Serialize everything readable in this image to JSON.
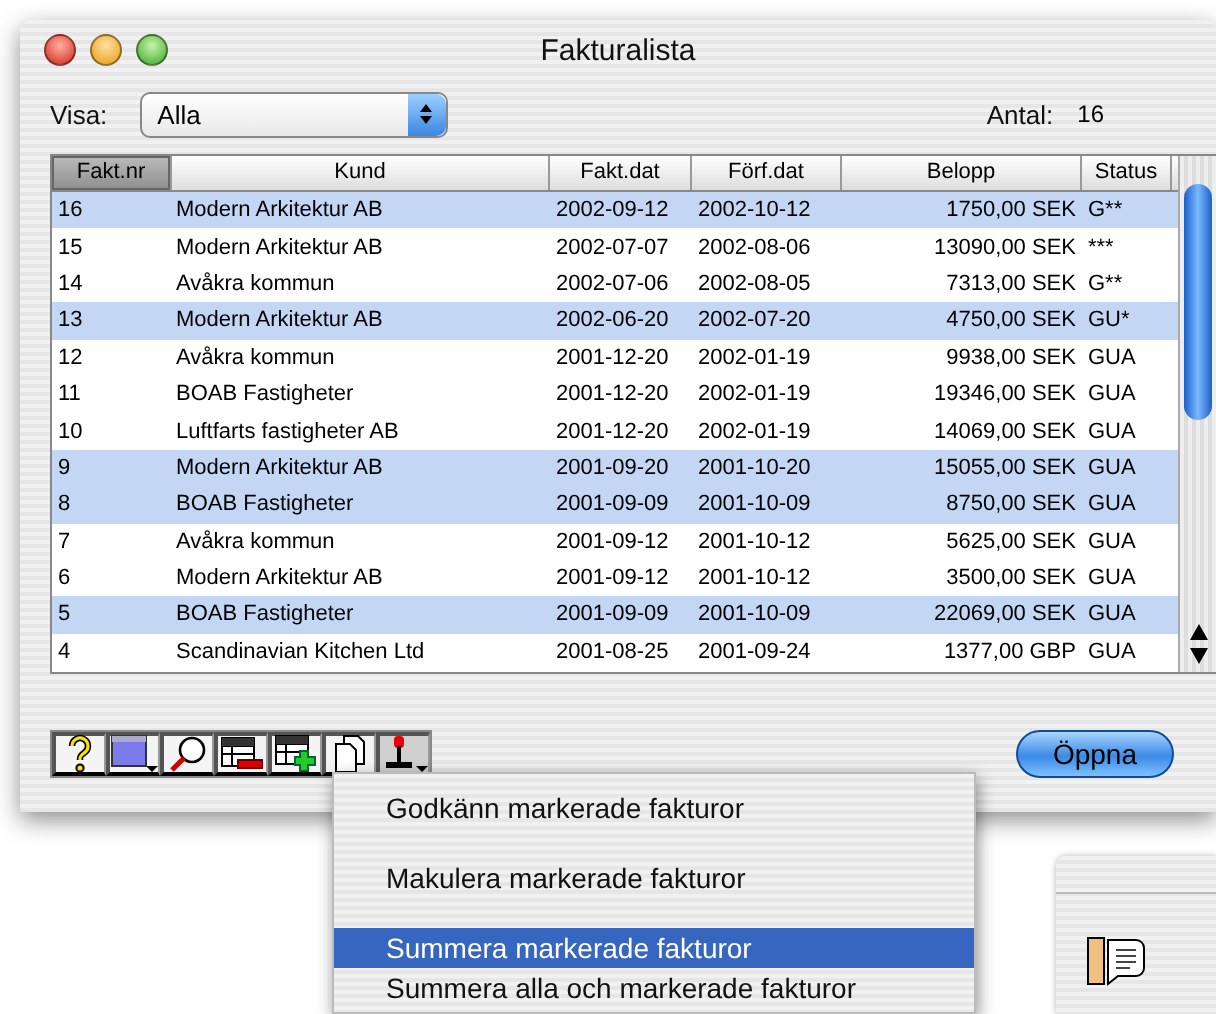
{
  "window": {
    "title": "Fakturalista"
  },
  "filter": {
    "label": "Visa:",
    "value": "Alla"
  },
  "count": {
    "label": "Antal:",
    "value": "16"
  },
  "table": {
    "columns": [
      {
        "label": "Fakt.nr",
        "sorted": true
      },
      {
        "label": "Kund",
        "sorted": false
      },
      {
        "label": "Fakt.dat",
        "sorted": false
      },
      {
        "label": "Förf.dat",
        "sorted": false
      },
      {
        "label": "Belopp",
        "sorted": false
      },
      {
        "label": "Status",
        "sorted": false
      }
    ],
    "rows": [
      {
        "cells": [
          "16",
          "Modern Arkitektur AB",
          "2002-09-12",
          "2002-10-12",
          "1750,00 SEK",
          "G**"
        ],
        "selected": true
      },
      {
        "cells": [
          "15",
          "Modern Arkitektur AB",
          "2002-07-07",
          "2002-08-06",
          "13090,00 SEK",
          "***"
        ],
        "selected": false
      },
      {
        "cells": [
          "14",
          "Avåkra kommun",
          "2002-07-06",
          "2002-08-05",
          "7313,00 SEK",
          "G**"
        ],
        "selected": false
      },
      {
        "cells": [
          "13",
          "Modern Arkitektur AB",
          "2002-06-20",
          "2002-07-20",
          "4750,00 SEK",
          "GU*"
        ],
        "selected": true
      },
      {
        "cells": [
          "12",
          "Avåkra kommun",
          "2001-12-20",
          "2002-01-19",
          "9938,00 SEK",
          "GUA"
        ],
        "selected": false
      },
      {
        "cells": [
          "11",
          "BOAB Fastigheter",
          "2001-12-20",
          "2002-01-19",
          "19346,00 SEK",
          "GUA"
        ],
        "selected": false
      },
      {
        "cells": [
          "10",
          "Luftfarts fastigheter AB",
          "2001-12-20",
          "2002-01-19",
          "14069,00 SEK",
          "GUA"
        ],
        "selected": false
      },
      {
        "cells": [
          "9",
          "Modern Arkitektur AB",
          "2001-09-20",
          "2001-10-20",
          "15055,00 SEK",
          "GUA"
        ],
        "selected": true
      },
      {
        "cells": [
          "8",
          "BOAB Fastigheter",
          "2001-09-09",
          "2001-10-09",
          "8750,00 SEK",
          "GUA"
        ],
        "selected": true
      },
      {
        "cells": [
          "7",
          "Avåkra kommun",
          "2001-09-12",
          "2001-10-12",
          "5625,00 SEK",
          "GUA"
        ],
        "selected": false
      },
      {
        "cells": [
          "6",
          "Modern Arkitektur AB",
          "2001-09-12",
          "2001-10-12",
          "3500,00 SEK",
          "GUA"
        ],
        "selected": false
      },
      {
        "cells": [
          "5",
          "BOAB Fastigheter",
          "2001-09-09",
          "2001-10-09",
          "22069,00 SEK",
          "GUA"
        ],
        "selected": true
      },
      {
        "cells": [
          "4",
          "Scandinavian Kitchen Ltd",
          "2001-08-25",
          "2001-09-24",
          "1377,00 GBP",
          "GUA"
        ],
        "selected": false
      }
    ]
  },
  "toolbar": [
    {
      "kind": "help"
    },
    {
      "kind": "window",
      "dropdown": true
    },
    {
      "kind": "search"
    },
    {
      "kind": "table-minus"
    },
    {
      "kind": "table-plus"
    },
    {
      "kind": "copy"
    },
    {
      "kind": "stamp",
      "dropdown": true
    }
  ],
  "open_button": {
    "label": "Öppna"
  },
  "menu": {
    "items": [
      {
        "label": "Godkänn markerade fakturor",
        "selected": false
      },
      {
        "label": "Makulera markerade fakturor",
        "selected": false
      },
      {
        "label": "Summera markerade fakturor",
        "selected": true
      },
      {
        "label": "Summera alla och markerade fakturor",
        "selected": false
      }
    ]
  }
}
